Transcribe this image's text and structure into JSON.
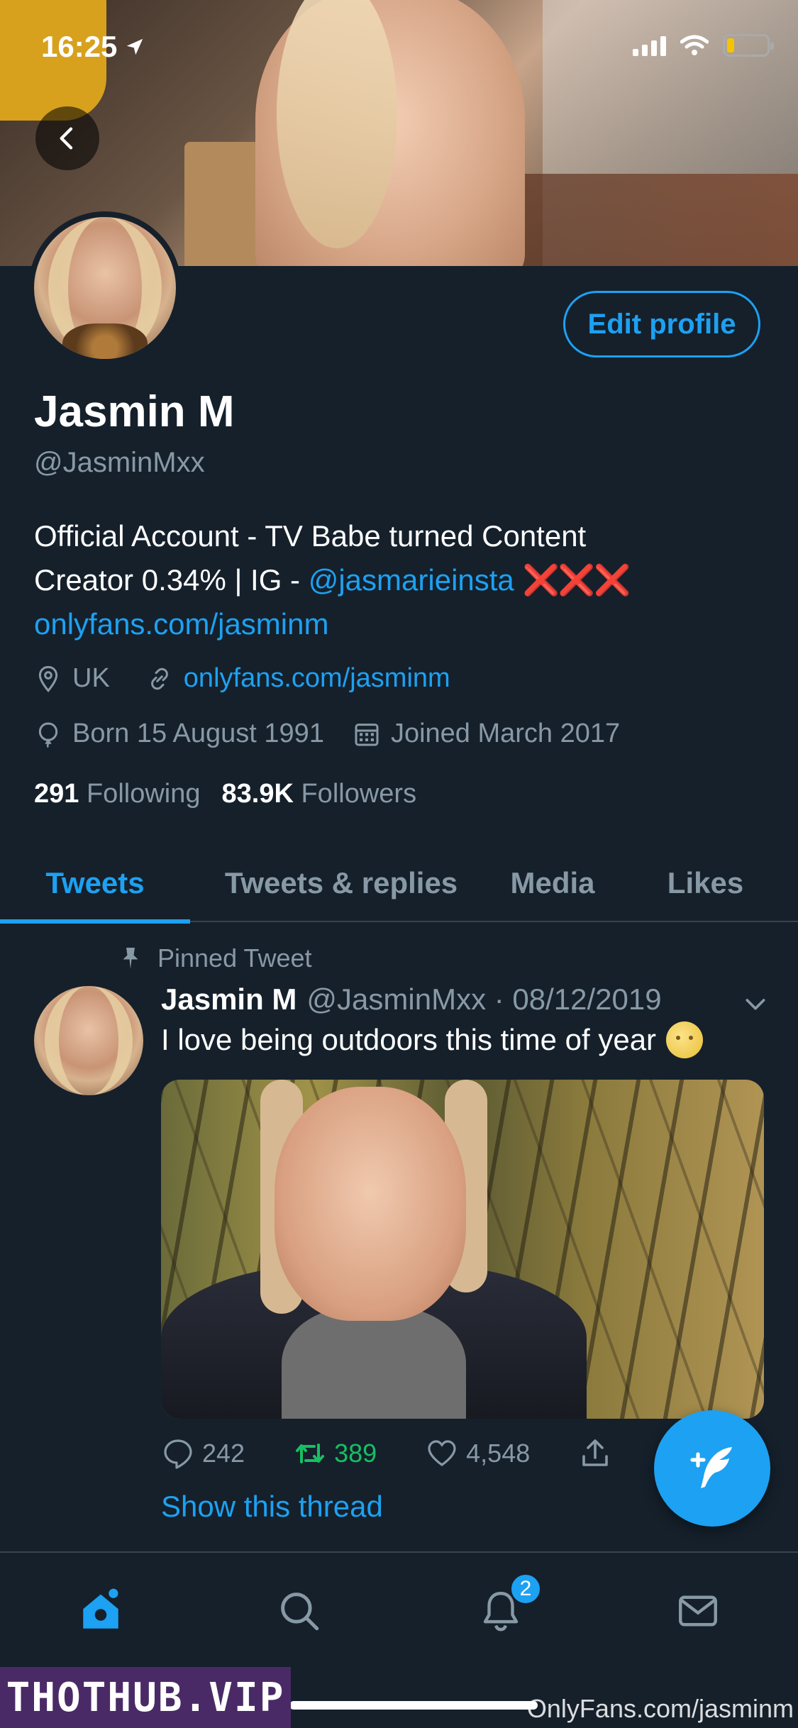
{
  "status_bar": {
    "time": "16:25"
  },
  "profile": {
    "name": "Jasmin M",
    "handle": "@JasminMxx",
    "edit_label": "Edit profile",
    "bio_line1": "Official Account - TV Babe turned Content",
    "bio_line2_prefix": "Creator 0.34% | IG - ",
    "bio_mention": "@jasmarieinsta",
    "bio_emoji": "❌❌❌",
    "bio_link": "onlyfans.com/jasminm",
    "location": "UK",
    "website": "onlyfans.com/jasminm",
    "born": "Born 15 August 1991",
    "joined": "Joined March 2017",
    "following_count": "291",
    "following_label": "Following",
    "followers_count": "83.9K",
    "followers_label": "Followers"
  },
  "tabs": [
    {
      "label": "Tweets",
      "active": true
    },
    {
      "label": "Tweets & replies",
      "active": false
    },
    {
      "label": "Media",
      "active": false
    },
    {
      "label": "Likes",
      "active": false
    }
  ],
  "tweet": {
    "pinned_label": "Pinned Tweet",
    "author_name": "Jasmin M",
    "author_handle_date": "@JasminMxx · 08/12/2019",
    "text": "I love being outdoors this time of year",
    "replies": "242",
    "retweets": "389",
    "likes": "4,548",
    "show_thread": "Show this thread"
  },
  "nav": {
    "notifications_badge": "2"
  },
  "watermarks": {
    "left": "THOTHUB.VIP",
    "right": "OnlyFans.com/jasminm"
  },
  "colors": {
    "background": "#15202b",
    "accent": "#1da1f2",
    "muted": "#8899a6",
    "retweet": "#17bf63"
  }
}
